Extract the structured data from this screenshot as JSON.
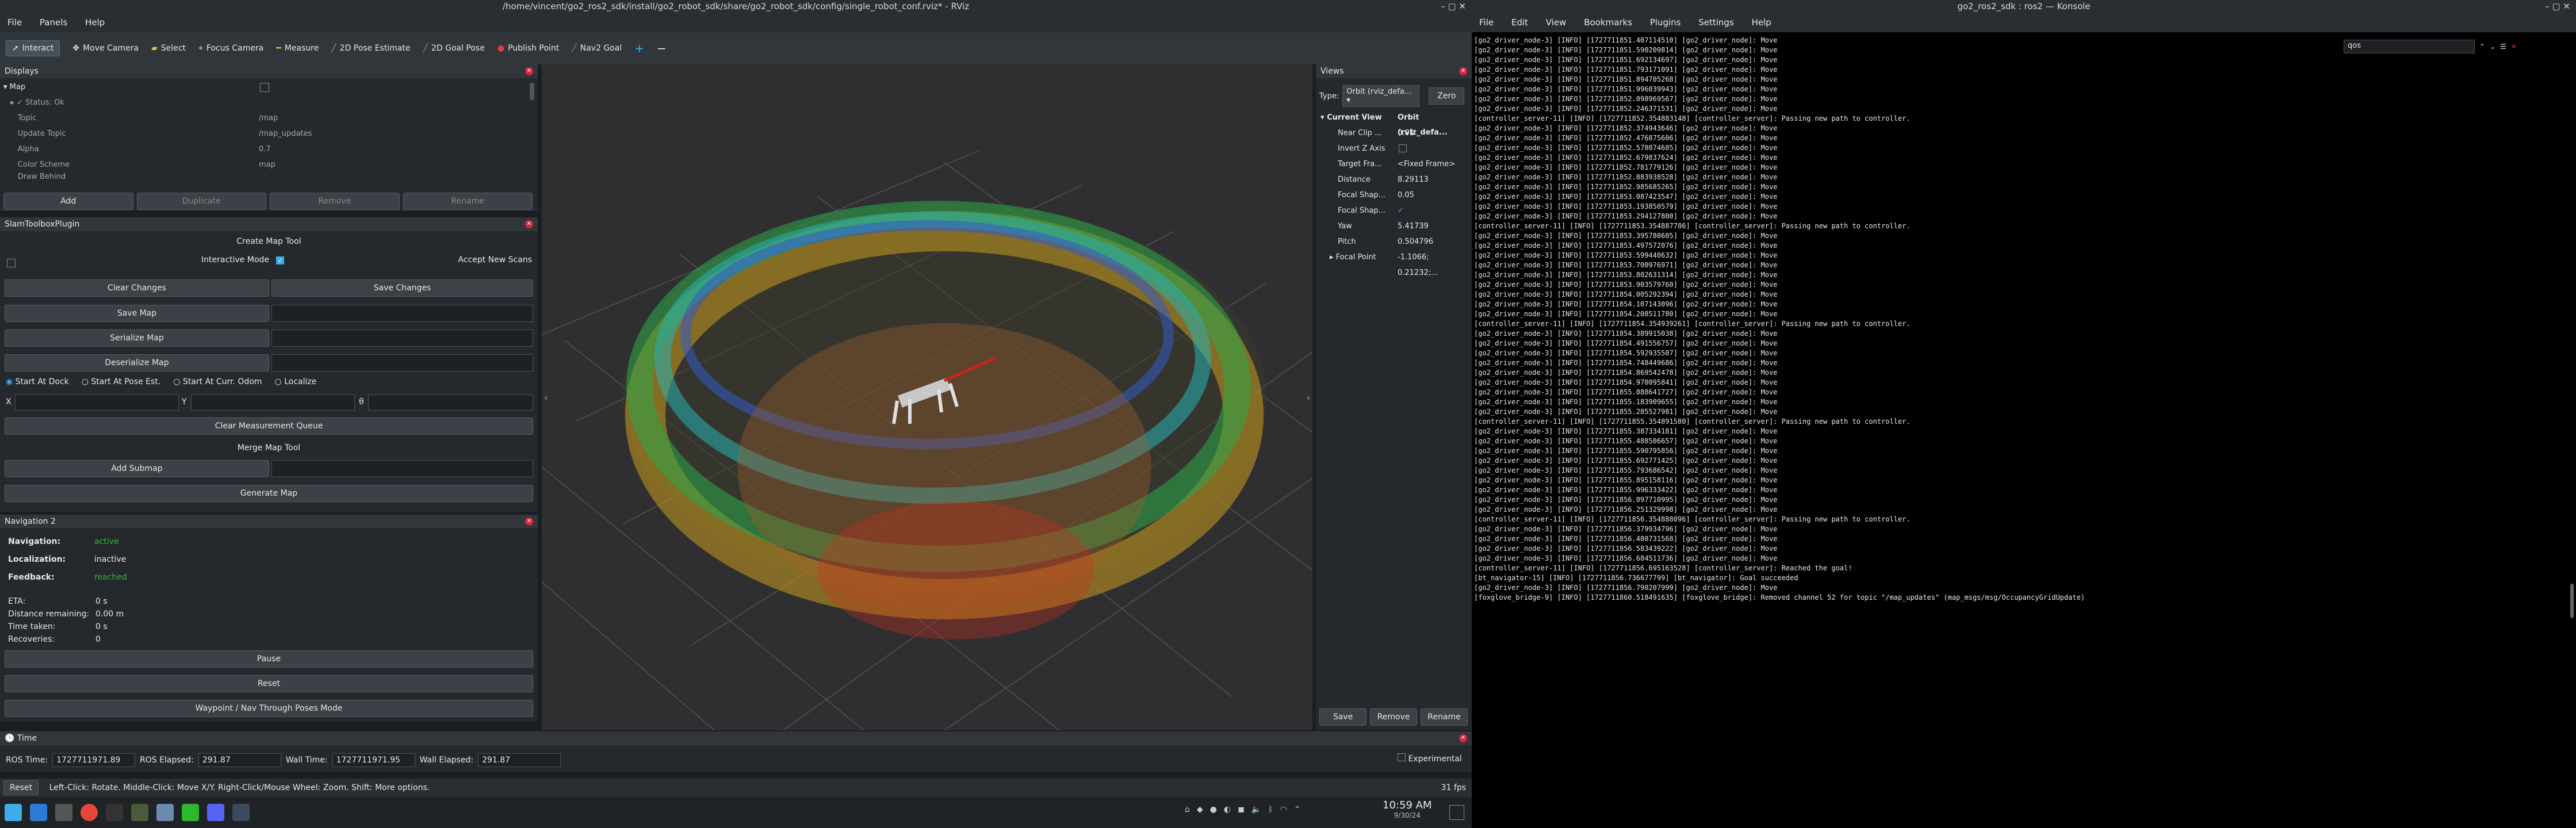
{
  "rviz": {
    "window_title": "/home/vincent/go2_ros2_sdk/install/go2_robot_sdk/share/go2_robot_sdk/config/single_robot_conf.rviz* - RViz",
    "menu": [
      "File",
      "Panels",
      "Help"
    ],
    "toolbar": [
      "Interact",
      "Move Camera",
      "Select",
      "Focus Camera",
      "Measure",
      "2D Pose Estimate",
      "2D Goal Pose",
      "Publish Point",
      "Nav2 Goal"
    ],
    "displays": {
      "title": "Displays",
      "tree": [
        {
          "label": "Map",
          "value": ""
        },
        {
          "label": "Status: Ok",
          "value": ""
        },
        {
          "label": "Topic",
          "value": "/map"
        },
        {
          "label": "Update Topic",
          "value": "/map_updates"
        },
        {
          "label": "Alpha",
          "value": "0.7"
        },
        {
          "label": "Color Scheme",
          "value": "map"
        },
        {
          "label": "Draw Behind",
          "value": ""
        }
      ],
      "buttons": [
        "Add",
        "Duplicate",
        "Remove",
        "Rename"
      ]
    },
    "slam": {
      "title": "SlamToolboxPlugin",
      "create_map_tool": "Create Map Tool",
      "interactive_mode": "Interactive Mode",
      "accept_new_scans": "Accept New Scans",
      "clear_changes": "Clear Changes",
      "save_changes": "Save Changes",
      "save_map": "Save Map",
      "serialize_map": "Serialize Map",
      "deserialize_map": "Deserialize Map",
      "radios": [
        "Start At Dock",
        "Start At Pose Est.",
        "Start At Curr. Odom",
        "Localize"
      ],
      "x_label": "X",
      "y_label": "Y",
      "theta_label": "θ",
      "clear_measurement_queue": "Clear Measurement Queue",
      "merge_map_tool": "Merge Map Tool",
      "add_submap": "Add Submap",
      "generate_map": "Generate Map"
    },
    "nav2": {
      "title": "Navigation 2",
      "navigation_label": "Navigation:",
      "navigation_value": "active",
      "localization_label": "Localization:",
      "localization_value": "inactive",
      "feedback_label": "Feedback:",
      "feedback_value": "reached",
      "eta_label": "ETA:",
      "eta_value": "0 s",
      "distance_label": "Distance remaining:",
      "distance_value": "0.00 m",
      "time_label": "Time taken:",
      "time_value": "0 s",
      "recoveries_label": "Recoveries:",
      "recoveries_value": "0",
      "pause": "Pause",
      "reset": "Reset",
      "waypoint": "Waypoint / Nav Through Poses Mode"
    },
    "views": {
      "title": "Views",
      "type_label": "Type:",
      "type_value": "Orbit (rviz_defa...",
      "zero": "Zero",
      "current_view": "Current View",
      "current_view_value": "Orbit (rviz_defa...",
      "props": [
        {
          "label": "Near Clip ...",
          "value": "0.01"
        },
        {
          "label": "Invert Z Axis",
          "value": ""
        },
        {
          "label": "Target Fra...",
          "value": "<Fixed Frame>"
        },
        {
          "label": "Distance",
          "value": "8.29113"
        },
        {
          "label": "Focal Shap...",
          "value": "0.05"
        },
        {
          "label": "Focal Shap...",
          "value": "✓"
        },
        {
          "label": "Yaw",
          "value": "5.41739"
        },
        {
          "label": "Pitch",
          "value": "0.504796"
        },
        {
          "label": "Focal Point",
          "value": "-1.1066; 0.21232;..."
        }
      ],
      "buttons": [
        "Save",
        "Remove",
        "Rename"
      ]
    },
    "time": {
      "title": "Time",
      "ros_time_label": "ROS Time:",
      "ros_time": "1727711971.89",
      "ros_elapsed_label": "ROS Elapsed:",
      "ros_elapsed": "291.87",
      "wall_time_label": "Wall Time:",
      "wall_time": "1727711971.95",
      "wall_elapsed_label": "Wall Elapsed:",
      "wall_elapsed": "291.87",
      "experimental": "Experimental"
    },
    "status": {
      "reset": "Reset",
      "hint": "Left-Click: Rotate. Middle-Click: Move X/Y. Right-Click/Mouse Wheel: Zoom. Shift: More options.",
      "fps": "31 fps"
    }
  },
  "konsole": {
    "window_title": "go2_ros2_sdk : ros2 — Konsole",
    "menu": [
      "File",
      "Edit",
      "View",
      "Bookmarks",
      "Plugins",
      "Settings",
      "Help"
    ],
    "search": "qos",
    "lines": [
      "[go2_driver_node-3] [INFO] [1727711851.407114510] [go2_driver_node]: Move",
      "[go2_driver_node-3] [INFO] [1727711851.590209814] [go2_driver_node]: Move",
      "[go2_driver_node-3] [INFO] [1727711851.692134697] [go2_driver_node]: Move",
      "[go2_driver_node-3] [INFO] [1727711851.793171091] [go2_driver_node]: Move",
      "[go2_driver_node-3] [INFO] [1727711851.894705268] [go2_driver_node]: Move",
      "[go2_driver_node-3] [INFO] [1727711851.996039943] [go2_driver_node]: Move",
      "[go2_driver_node-3] [INFO] [1727711852.098969567] [go2_driver_node]: Move",
      "[go2_driver_node-3] [INFO] [1727711852.246371531] [go2_driver_node]: Move",
      "[controller_server-11] [INFO] [1727711852.354883148] [controller_server]: Passing new path to controller.",
      "[go2_driver_node-3] [INFO] [1727711852.374943646] [go2_driver_node]: Move",
      "[go2_driver_node-3] [INFO] [1727711852.476875606] [go2_driver_node]: Move",
      "[go2_driver_node-3] [INFO] [1727711852.578074685] [go2_driver_node]: Move",
      "[go2_driver_node-3] [INFO] [1727711852.679837624] [go2_driver_node]: Move",
      "[go2_driver_node-3] [INFO] [1727711852.781779126] [go2_driver_node]: Move",
      "[go2_driver_node-3] [INFO] [1727711852.883938528] [go2_driver_node]: Move",
      "[go2_driver_node-3] [INFO] [1727711852.985685265] [go2_driver_node]: Move",
      "[go2_driver_node-3] [INFO] [1727711853.087423547] [go2_driver_node]: Move",
      "[go2_driver_node-3] [INFO] [1727711853.193850579] [go2_driver_node]: Move",
      "[go2_driver_node-3] [INFO] [1727711853.294127800] [go2_driver_node]: Move",
      "[controller_server-11] [INFO] [1727711853.354887786] [controller_server]: Passing new path to controller.",
      "[go2_driver_node-3] [INFO] [1727711853.395780605] [go2_driver_node]: Move",
      "[go2_driver_node-3] [INFO] [1727711853.497572076] [go2_driver_node]: Move",
      "[go2_driver_node-3] [INFO] [1727711853.599440632] [go2_driver_node]: Move",
      "[go2_driver_node-3] [INFO] [1727711853.700976971] [go2_driver_node]: Move",
      "[go2_driver_node-3] [INFO] [1727711853.802631314] [go2_driver_node]: Move",
      "[go2_driver_node-3] [INFO] [1727711853.903579760] [go2_driver_node]: Move",
      "[go2_driver_node-3] [INFO] [1727711854.005292394] [go2_driver_node]: Move",
      "[go2_driver_node-3] [INFO] [1727711854.107143096] [go2_driver_node]: Move",
      "[go2_driver_node-3] [INFO] [1727711854.208511780] [go2_driver_node]: Move",
      "[controller_server-11] [INFO] [1727711854.354939261] [controller_server]: Passing new path to controller.",
      "[go2_driver_node-3] [INFO] [1727711854.389915038] [go2_driver_node]: Move",
      "[go2_driver_node-3] [INFO] [1727711854.491556757] [go2_driver_node]: Move",
      "[go2_driver_node-3] [INFO] [1727711854.592935507] [go2_driver_node]: Move",
      "[go2_driver_node-3] [INFO] [1727711854.748449686] [go2_driver_node]: Move",
      "[go2_driver_node-3] [INFO] [1727711854.869542478] [go2_driver_node]: Move",
      "[go2_driver_node-3] [INFO] [1727711854.970095841] [go2_driver_node]: Move",
      "[go2_driver_node-3] [INFO] [1727711855.088641727] [go2_driver_node]: Move",
      "[go2_driver_node-3] [INFO] [1727711855.183909655] [go2_driver_node]: Move",
      "[go2_driver_node-3] [INFO] [1727711855.285527981] [go2_driver_node]: Move",
      "[controller_server-11] [INFO] [1727711855.354891580] [controller_server]: Passing new path to controller.",
      "[go2_driver_node-3] [INFO] [1727711855.387334181] [go2_driver_node]: Move",
      "[go2_driver_node-3] [INFO] [1727711855.488506657] [go2_driver_node]: Move",
      "[go2_driver_node-3] [INFO] [1727711855.590795856] [go2_driver_node]: Move",
      "[go2_driver_node-3] [INFO] [1727711855.692771425] [go2_driver_node]: Move",
      "[go2_driver_node-3] [INFO] [1727711855.793686542] [go2_driver_node]: Move",
      "[go2_driver_node-3] [INFO] [1727711855.895158116] [go2_driver_node]: Move",
      "[go2_driver_node-3] [INFO] [1727711855.996333422] [go2_driver_node]: Move",
      "[go2_driver_node-3] [INFO] [1727711856.097710995] [go2_driver_node]: Move",
      "[go2_driver_node-3] [INFO] [1727711856.251329998] [go2_driver_node]: Move",
      "[controller_server-11] [INFO] [1727711856.354888096] [controller_server]: Passing new path to controller.",
      "[go2_driver_node-3] [INFO] [1727711856.379934796] [go2_driver_node]: Move",
      "[go2_driver_node-3] [INFO] [1727711856.480731568] [go2_driver_node]: Move",
      "[go2_driver_node-3] [INFO] [1727711856.583439222] [go2_driver_node]: Move",
      "[go2_driver_node-3] [INFO] [1727711856.684511736] [go2_driver_node]: Move",
      "[controller_server-11] [INFO] [1727711856.695163528] [controller_server]: Reached the goal!",
      "[bt_navigator-15] [INFO] [1727711856.736677799] [bt_navigator]: Goal succeeded",
      "[go2_driver_node-3] [INFO] [1727711856.790207999] [go2_driver_node]: Move",
      "[foxglove_bridge-9] [INFO] [1727711860.518491635] [foxglove_bridge]: Removed channel 52 for topic \"/map_updates\" (map_msgs/msg/OccupancyGridUpdate)"
    ]
  },
  "taskbar": {
    "time": "10:59 AM",
    "date": "9/30/24"
  },
  "colors": {
    "accent": "#3daee9",
    "close": "#d7263d",
    "active_green": "#2eb82e"
  }
}
